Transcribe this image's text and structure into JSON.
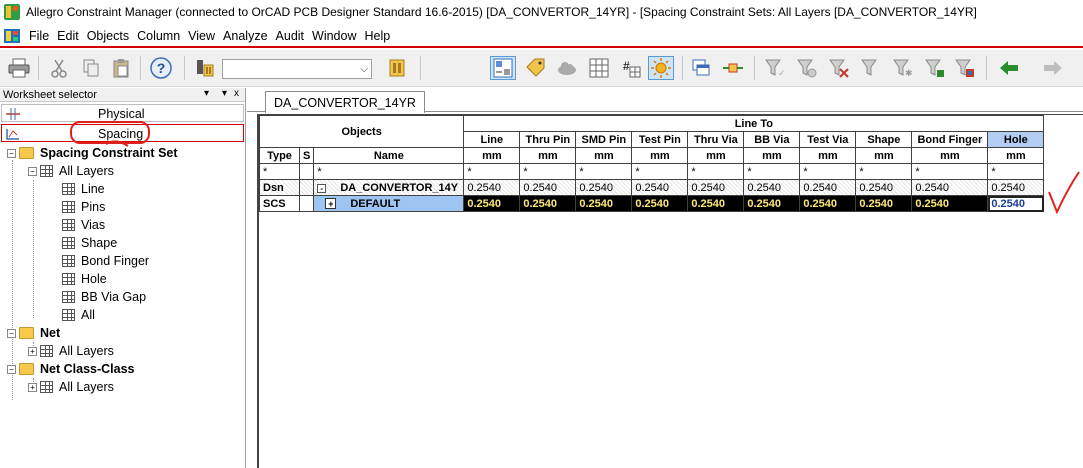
{
  "window": {
    "title": "Allegro Constraint Manager (connected to OrCAD PCB Designer Standard 16.6-2015) [DA_CONVERTOR_14YR] - [Spacing Constraint Sets:  All Layers [DA_CONVERTOR_14YR]"
  },
  "menu": [
    "File",
    "Edit",
    "Objects",
    "Column",
    "View",
    "Analyze",
    "Audit",
    "Window",
    "Help"
  ],
  "toolbar": {
    "combo_value": "",
    "icons": [
      "print-icon",
      "cut-icon",
      "copy-icon",
      "paste-icon",
      "help-icon",
      "tool-icon",
      "pcb-icon",
      "spacing-icon",
      "tag-icon",
      "cloud-icon",
      "grid-icon",
      "grid-alt-icon",
      "sun-icon",
      "windows-icon",
      "net-icon",
      "filter-icon",
      "filter-x-icon",
      "filter-icon-2",
      "filter-icon-3",
      "filter-icon-4",
      "filter-icon-5",
      "filter-icon-6",
      "back-arrow-icon",
      "forward-arrow-icon"
    ]
  },
  "worksheet_selector": {
    "title": "Worksheet selector",
    "controls": [
      "▾",
      "x"
    ],
    "items": [
      {
        "label": "Physical"
      },
      {
        "label": "Spacing"
      }
    ]
  },
  "tree": [
    {
      "label": "Spacing Constraint Set",
      "bold": true,
      "level": 0,
      "type": "folder",
      "expander": "-"
    },
    {
      "label": "All Layers",
      "level": 1,
      "type": "grid",
      "expander": "-"
    },
    {
      "label": "Line",
      "level": 2,
      "type": "grid"
    },
    {
      "label": "Pins",
      "level": 2,
      "type": "grid"
    },
    {
      "label": "Vias",
      "level": 2,
      "type": "grid"
    },
    {
      "label": "Shape",
      "level": 2,
      "type": "grid"
    },
    {
      "label": "Bond Finger",
      "level": 2,
      "type": "grid"
    },
    {
      "label": "Hole",
      "level": 2,
      "type": "grid"
    },
    {
      "label": "BB Via Gap",
      "level": 2,
      "type": "grid"
    },
    {
      "label": "All",
      "level": 2,
      "type": "grid"
    },
    {
      "label": "Net",
      "bold": true,
      "level": 0,
      "type": "folder",
      "expander": "-"
    },
    {
      "label": "All Layers",
      "level": 1,
      "type": "grid",
      "expander": "+"
    },
    {
      "label": "Net Class-Class",
      "bold": true,
      "level": 0,
      "type": "folder",
      "expander": "-"
    },
    {
      "label": "All Layers",
      "level": 1,
      "type": "grid",
      "expander": "+"
    }
  ],
  "tab": {
    "label": "DA_CONVERTOR_14YR"
  },
  "grid": {
    "objects_header": "Objects",
    "line_to_header": "Line To",
    "type_header": "Type",
    "s_header": "S",
    "name_header": "Name",
    "columns": [
      "Line",
      "Thru Pin",
      "SMD Pin",
      "Test Pin",
      "Thru Via",
      "BB Via",
      "Test Via",
      "Shape",
      "Bond Finger",
      "Hole"
    ],
    "unit": "mm",
    "filter": "*",
    "rows": [
      {
        "type": "Dsn",
        "expander": "-",
        "name": "DA_CONVERTOR_14Y",
        "values": [
          "0.2540",
          "0.2540",
          "0.2540",
          "0.2540",
          "0.2540",
          "0.2540",
          "0.2540",
          "0.2540",
          "0.2540",
          "0.2540"
        ]
      },
      {
        "type": "SCS",
        "expander": "+",
        "name": "DEFAULT",
        "values": [
          "0.2540",
          "0.2540",
          "0.2540",
          "0.2540",
          "0.2540",
          "0.2540",
          "0.2540",
          "0.2540",
          "0.2540",
          "0.2540"
        ]
      }
    ]
  },
  "colors": {
    "selection_blue": "#9ec5f2",
    "annotation_red": "#e0201b",
    "value_yellow": "#ffe87a"
  }
}
